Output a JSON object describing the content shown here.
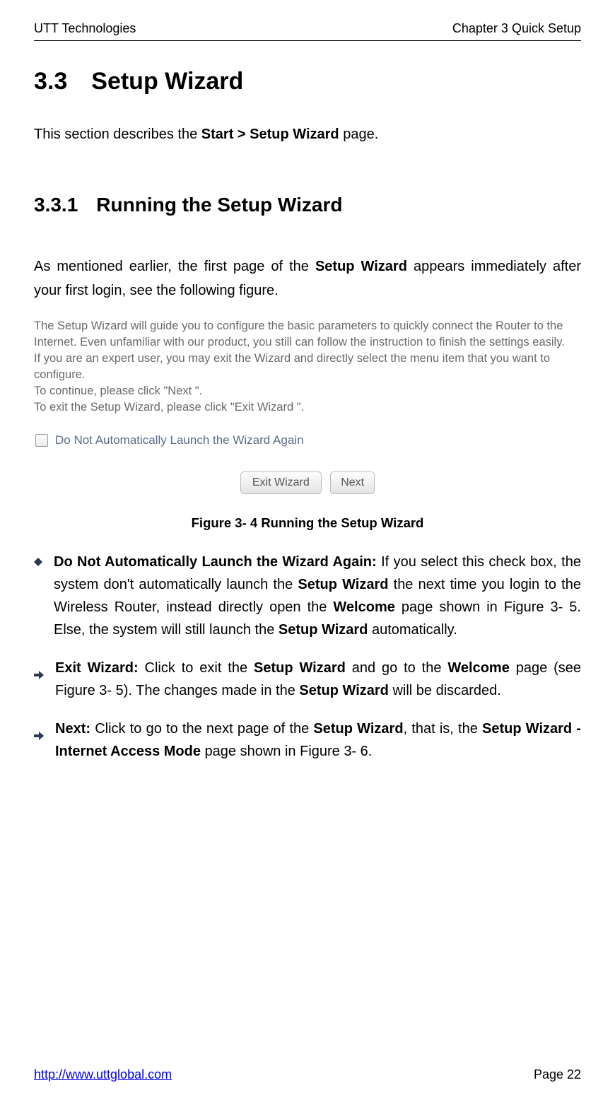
{
  "header": {
    "left": "UTT Technologies",
    "right": "Chapter 3 Quick Setup"
  },
  "section": {
    "h1_num": "3.3",
    "h1_title": "Setup Wizard",
    "intro_prefix": "This section describes the ",
    "intro_bold": "Start > Setup Wizard",
    "intro_suffix": " page.",
    "h2_num": "3.3.1",
    "h2_title": "Running the Setup Wizard",
    "body_prefix": "As mentioned earlier, the first page of the ",
    "body_bold": "Setup Wizard",
    "body_suffix": " appears immediately after your first login, see the following figure."
  },
  "wizard_panel": {
    "line1": "The Setup Wizard will guide you to configure the basic parameters to quickly connect the Router to the",
    "line2": "Internet. Even unfamiliar with our product, you still can follow the instruction to finish the settings easily.",
    "line3": "If you are an expert user, you may exit the Wizard and directly select the menu item that you want to configure.",
    "line4": "To continue, please click \"Next \".",
    "line5": "To exit the Setup Wizard, please click \"Exit Wizard \".",
    "checkbox_label": "Do Not Automatically Launch the Wizard Again",
    "exit_button": "Exit Wizard",
    "next_button": "Next"
  },
  "figure_caption": "Figure 3- 4 Running the Setup Wizard",
  "bullets": {
    "b1": {
      "bold1": "Do Not Automatically Launch the Wizard Again:",
      "t1": " If you select this check box, the system don't automatically launch the ",
      "bold2": "Setup Wizard",
      "t2": " the next time you login to the Wireless Router, instead directly open the ",
      "bold3": "Welcome",
      "t3": " page shown in Figure 3- 5. Else, the system will still launch the ",
      "bold4": "Setup Wizard",
      "t4": " automatically."
    },
    "b2": {
      "bold1": "Exit Wizard:",
      "t1": " Click to exit the ",
      "bold2": "Setup Wizard",
      "t2": " and go to the ",
      "bold3": "Welcome",
      "t3": " page (see Figure 3- 5). The changes made in the ",
      "bold4": "Setup Wizard",
      "t4": " will be discarded."
    },
    "b3": {
      "bold1": "Next:",
      "t1": " Click to go to the next page of the ",
      "bold2": "Setup Wizard",
      "t2": ", that is, the ",
      "bold3": "Setup Wizard - Internet Access Mode",
      "t3": " page shown in Figure 3- 6."
    }
  },
  "footer": {
    "link": "http://www.uttglobal.com",
    "page": "Page 22"
  }
}
